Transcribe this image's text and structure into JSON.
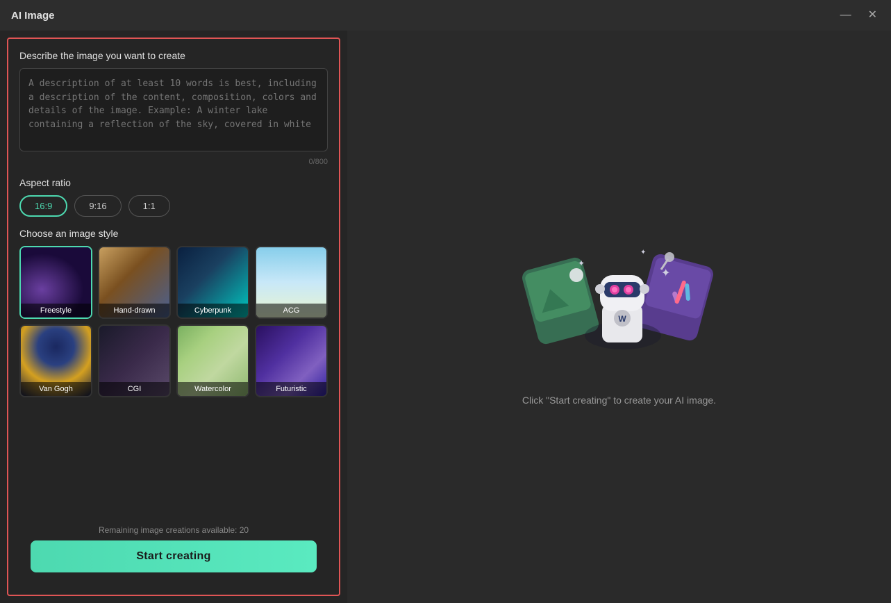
{
  "window": {
    "title": "AI Image",
    "minimize_label": "minimize",
    "close_label": "close"
  },
  "left": {
    "describe_label": "Describe the image you want to create",
    "textarea_placeholder": "A description of at least 10 words is best, including a description of the content, composition, colors and details of the image. Example: A winter lake containing a reflection of the sky, covered in white",
    "char_count": "0/800",
    "aspect_ratio_label": "Aspect ratio",
    "aspect_options": [
      "16:9",
      "9:16",
      "1:1"
    ],
    "aspect_selected": "16:9",
    "style_label": "Choose an image style",
    "styles": [
      {
        "name": "Freestyle",
        "thumb": "freestyle",
        "selected": true
      },
      {
        "name": "Hand-drawn",
        "thumb": "handdrawn",
        "selected": false
      },
      {
        "name": "Cyberpunk",
        "thumb": "cyberpunk",
        "selected": false
      },
      {
        "name": "ACG",
        "thumb": "acg",
        "selected": false
      },
      {
        "name": "Van Gogh",
        "thumb": "vangogh",
        "selected": false
      },
      {
        "name": "CGI",
        "thumb": "cgi",
        "selected": false
      },
      {
        "name": "Watercolor",
        "thumb": "watercolor",
        "selected": false
      },
      {
        "name": "Futuristic",
        "thumb": "futuristic",
        "selected": false
      }
    ],
    "remaining_text": "Remaining image creations available: 20",
    "start_button_label": "Start creating"
  },
  "right": {
    "hint_text": "Click \"Start creating\" to create your AI image."
  }
}
